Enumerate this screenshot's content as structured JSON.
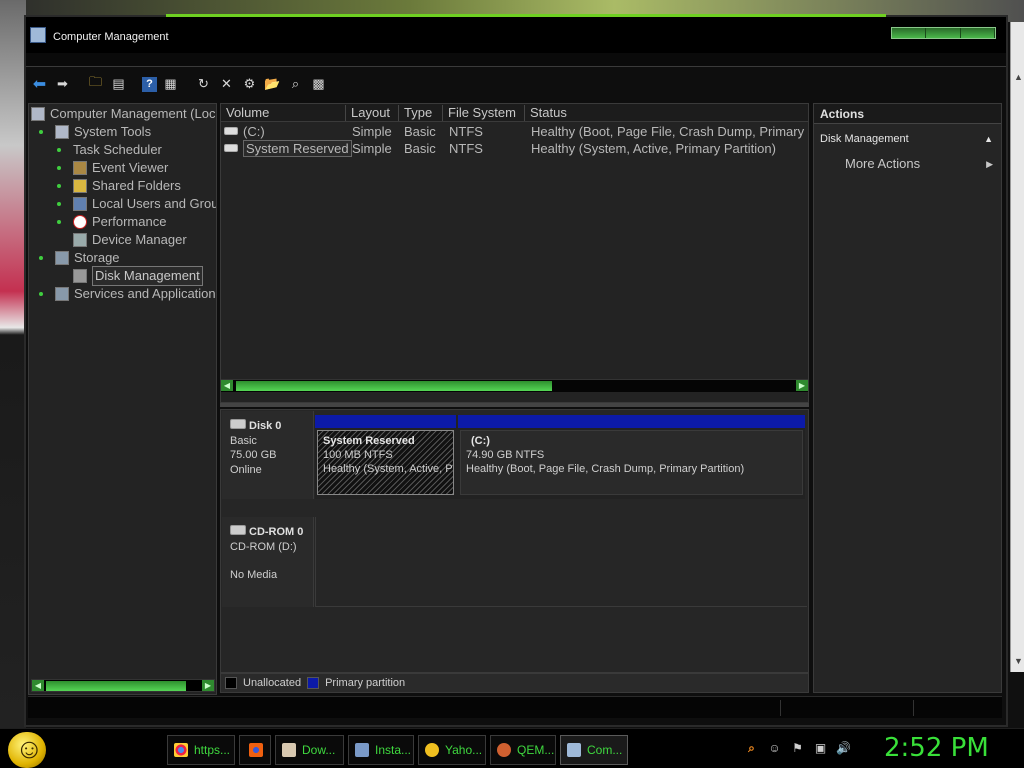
{
  "window": {
    "title": "Computer Management"
  },
  "toolbar": {
    "icons": [
      "back-icon",
      "forward-icon",
      "up-folder-icon",
      "show-hide-tree-icon",
      "help-icon",
      "properties-icon",
      "refresh-icon",
      "delete-icon",
      "connect-icon",
      "open-icon",
      "search-icon",
      "console-icon"
    ]
  },
  "tree": {
    "root": "Computer Management (Loc",
    "system_tools": "System Tools",
    "task_scheduler": "Task Scheduler",
    "event_viewer": "Event Viewer",
    "shared_folders": "Shared Folders",
    "local_users": "Local Users and Grou",
    "performance": "Performance",
    "device_manager": "Device Manager",
    "storage": "Storage",
    "disk_management": "Disk Management",
    "services": "Services and Application"
  },
  "volumes": {
    "columns": [
      "Volume",
      "Layout",
      "Type",
      "File System",
      "Status"
    ],
    "rows": [
      {
        "volume": "(C:)",
        "layout": "Simple",
        "type": "Basic",
        "fs": "NTFS",
        "status": "Healthy (Boot, Page File, Crash Dump, Primary"
      },
      {
        "volume": "System Reserved",
        "layout": "Simple",
        "type": "Basic",
        "fs": "NTFS",
        "status": "Healthy (System, Active, Primary Partition)"
      }
    ]
  },
  "disks": {
    "disk0": {
      "name": "Disk 0",
      "type": "Basic",
      "size": "75.00 GB",
      "state": "Online",
      "partitions": [
        {
          "name": "System Reserved",
          "size": "100 MB NTFS",
          "status": "Healthy (System, Active, P"
        },
        {
          "name": "(C:)",
          "size": "74.90 GB NTFS",
          "status": "Healthy (Boot, Page File, Crash Dump, Primary Partition)"
        }
      ]
    },
    "cdrom0": {
      "name": "CD-ROM 0",
      "drive": "CD-ROM (D:)",
      "state": "No Media"
    }
  },
  "legend": {
    "unallocated": "Unallocated",
    "primary": "Primary partition"
  },
  "actions": {
    "title": "Actions",
    "section": "Disk Management",
    "more": "More Actions"
  },
  "taskbar": {
    "tasks": [
      {
        "label": "https...",
        "icon": "chrome-icon"
      },
      {
        "label": "",
        "icon": "firefox-icon"
      },
      {
        "label": "Dow...",
        "icon": "download-icon"
      },
      {
        "label": "Insta...",
        "icon": "installer-icon"
      },
      {
        "label": "Yaho...",
        "icon": "yahoo-messenger-icon"
      },
      {
        "label": "QEM...",
        "icon": "qemu-icon"
      },
      {
        "label": "Com...",
        "icon": "computer-management-icon"
      }
    ],
    "clock": "2:52 PM"
  },
  "colors": {
    "accent": "#3fd83f",
    "primary_partition": "#0c1aa8"
  }
}
